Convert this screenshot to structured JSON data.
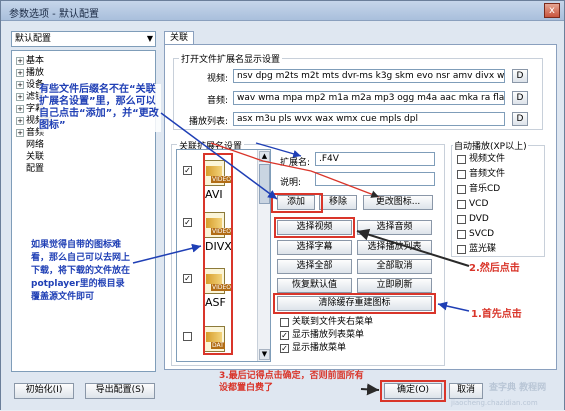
{
  "window": {
    "title": "参数选项 - 默认配置",
    "close_glyph": "x"
  },
  "config_select": {
    "value": "默认配置",
    "arrow": "▼"
  },
  "tree": {
    "expanded_items": [
      "基本",
      "播放",
      "设备",
      "滤镜",
      "字幕",
      "视频帧",
      "音频"
    ],
    "leaf_items": [
      "网络",
      "关联",
      "配置"
    ]
  },
  "tab": {
    "label": "关联"
  },
  "ext_group": {
    "title": "打开文件扩展名显示设置",
    "rows": [
      {
        "label": "视频:",
        "value": "nsv dpg m2ts m2t mts dvr-ms k3g skm evo nsr amv divx webm",
        "btn": "D"
      },
      {
        "label": "音频:",
        "value": "wav wma mpa mp2 m1a m2a mp3 ogg m4a aac mka ra flac ape",
        "btn": "D"
      },
      {
        "label": "播放列表:",
        "value": "asx m3u pls wvx wax wmx cue mpls dpl",
        "btn": "D"
      }
    ]
  },
  "icon_group": {
    "title": "关联扩展名设置",
    "icons": [
      {
        "label": "AVI",
        "badge": "VIDEO",
        "checked": true
      },
      {
        "label": "DIVX",
        "badge": "VIDEO",
        "checked": true
      },
      {
        "label": "ASF",
        "badge": "VIDEO",
        "checked": true
      },
      {
        "label": "",
        "badge": "DAT",
        "checked": false
      }
    ],
    "check_glyph": "✓"
  },
  "ext_editor": {
    "ext_label": "扩展名:",
    "ext_value": ".F4V",
    "desc_label": "说明:",
    "desc_value": "",
    "add": "添加",
    "remove": "移除",
    "change_icon": "更改图标..."
  },
  "assoc_buttons": {
    "select_video": "选择视频",
    "select_audio": "选择音频",
    "select_subtitle": "选择字幕",
    "select_playlist": "选择播放列表",
    "select_all": "选择全部",
    "deselect_all": "全部取消",
    "restore_default": "恢复默认值",
    "refresh_now": "立即刷新",
    "clear_cache": "清除缓存重建图标"
  },
  "options": [
    {
      "label": "关联到文件夹右菜单",
      "checked": false
    },
    {
      "label": "显示播放列表菜单",
      "checked": true
    },
    {
      "label": "显示播放菜单",
      "checked": true
    }
  ],
  "autoplay": {
    "title": "自动播放(XP以上)",
    "items": [
      "视频文件",
      "音频文件",
      "音乐CD",
      "VCD",
      "DVD",
      "SVCD",
      "蓝光碟"
    ]
  },
  "footer": {
    "init": "初始化(I)",
    "export": "导出配置(S)",
    "ok": "确定(O)",
    "cancel": "取消",
    "watermark": "查字典 教程网",
    "watermark_url": "jiaocheng.chazidian.com"
  },
  "annotations": {
    "note_top": "有些文件后缀名不在“关联扩展名设置”里，那么可以自己点击“添加”，并“更改图标”",
    "note_left": "如果觉得自带的图标难看，那么自己可以去网上下载，将下载的文件放在potplayer里的根目录覆盖源文件即可",
    "note_step1": "1.首先点击",
    "note_step2": "2.然后点击",
    "note_step3": "3.最后记得点击确定，否则前面所有设都置白费了",
    "color_blue": "#1f3fb5",
    "color_red": "#d9352a"
  }
}
